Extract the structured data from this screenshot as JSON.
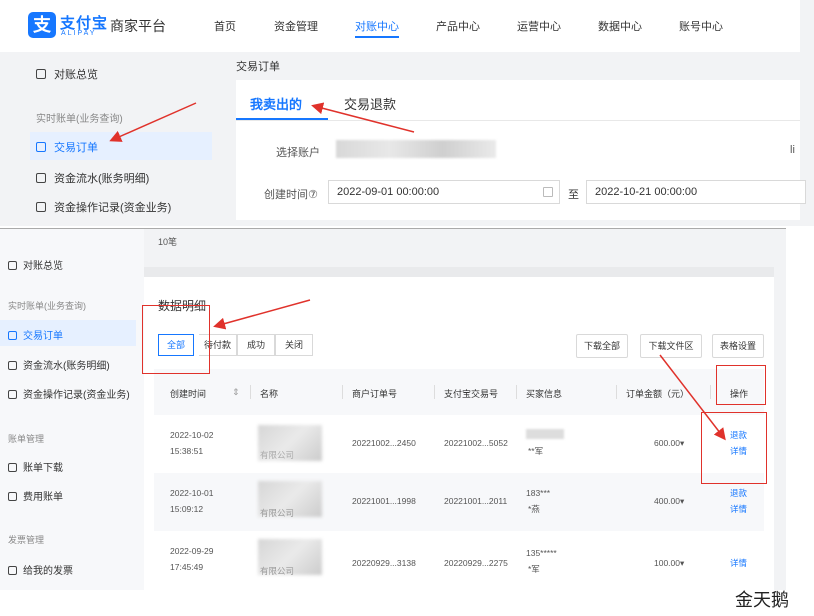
{
  "top": {
    "logo": {
      "cn": "支付宝",
      "en": "ALIPAY",
      "mark": "支"
    },
    "site_title": "商家平台",
    "nav": [
      "首页",
      "资金管理",
      "对账中心",
      "产品中心",
      "运营中心",
      "数据中心",
      "账号中心"
    ],
    "active_nav": "对账中心",
    "sidebar": {
      "overview": "对账总览",
      "group": "实时账单(业务查询)",
      "items": [
        "交易订单",
        "资金流水(账务明细)",
        "资金操作记录(资金业务)"
      ]
    },
    "breadcrumb": "交易订单",
    "tabs": [
      "我卖出的",
      "交易退款"
    ],
    "form": {
      "account_label": "选择账户",
      "account_suffix": "li",
      "created_label": "创建时间⑦",
      "start": "2022-09-01 00:00:00",
      "to": "至",
      "end": "2022-10-21 00:00:00"
    }
  },
  "bottom": {
    "count_text": "10笔",
    "sidebar": {
      "overview": "对账总览",
      "group1": "实时账单(业务查询)",
      "items1": [
        "交易订单",
        "资金流水(账务明细)",
        "资金操作记录(资金业务)"
      ],
      "group2": "账单管理",
      "items2": [
        "账单下载",
        "费用账单"
      ],
      "group3": "发票管理",
      "items3": [
        "给我的发票"
      ]
    },
    "section_title": "数据明细",
    "filters": [
      "全部",
      "待付款",
      "成功",
      "关闭"
    ],
    "tools": [
      "下载全部",
      "下载文件区",
      "表格设置"
    ],
    "columns": [
      "创建时间",
      "名称",
      "商户订单号",
      "支付宝交易号",
      "买家信息",
      "订单金额（元）",
      "操作"
    ],
    "rows": [
      {
        "date": "2022-10-02",
        "time": "15:38:51",
        "name_partial": "有限公司",
        "merchant_no": "20221002...2450",
        "trade_no": "20221002...5052",
        "buyer_1": "",
        "buyer_2": "**军",
        "amount": "600.00▾",
        "actions": [
          "退款",
          "详情"
        ]
      },
      {
        "date": "2022-10-01",
        "time": "15:09:12",
        "name_partial": "有限公司",
        "merchant_no": "20221001...1998",
        "trade_no": "20221001...2011",
        "buyer_1": "183***",
        "buyer_2": "*燕",
        "amount": "400.00▾",
        "actions": [
          "退款",
          "详情"
        ]
      },
      {
        "date": "2022-09-29",
        "time": "17:45:49",
        "name_partial": "有限公司",
        "merchant_no": "20220929...3138",
        "trade_no": "20220929...2275",
        "buyer_1": "135*****",
        "buyer_2": "*军",
        "amount": "100.00▾",
        "actions": [
          "详情"
        ]
      }
    ]
  },
  "watermark": "金天鹅",
  "colors": {
    "accent": "#1677ff",
    "annotation": "#e0322b"
  }
}
